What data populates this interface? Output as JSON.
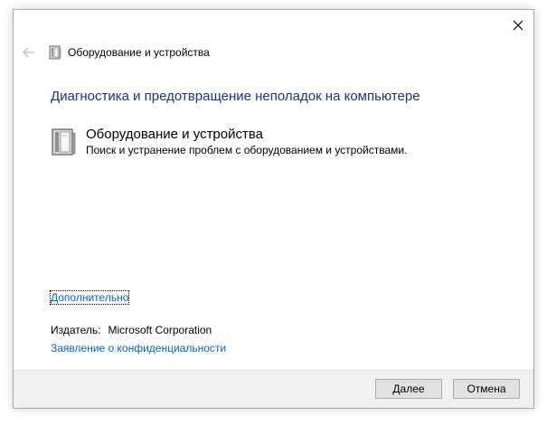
{
  "window": {
    "title": "Оборудование и устройства"
  },
  "main": {
    "heading": "Диагностика и предотвращение неполадок на компьютере",
    "item": {
      "title": "Оборудование и устройства",
      "description": "Поиск и устранение проблем с оборудованием и устройствами."
    },
    "advanced_link": "Дополнительно",
    "publisher_label": "Издатель:",
    "publisher_value": "Microsoft Corporation",
    "privacy_link": "Заявление о конфиденциальности"
  },
  "footer": {
    "next_label": "Далее",
    "cancel_label": "Отмена"
  },
  "icons": {
    "close": "close-icon",
    "back": "back-arrow-icon",
    "device": "hardware-device-icon"
  },
  "colors": {
    "heading": "#1e3287",
    "link": "#0066cc",
    "footer_bg": "#f0f0f0"
  }
}
